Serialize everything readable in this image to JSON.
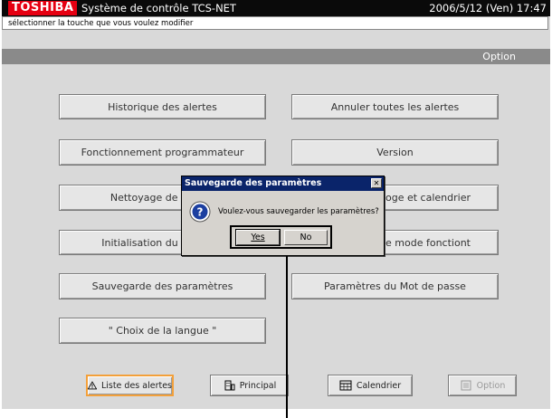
{
  "header": {
    "brand": "TOSHIBA",
    "app_title": "Système de contrôle TCS-NET",
    "datetime": "2006/5/12 (Ven)  17:47",
    "hint": "sélectionner la touche que vous voulez modifier"
  },
  "section": {
    "title": "Option"
  },
  "menu": [
    {
      "id": "history",
      "label": "Historique des alertes"
    },
    {
      "id": "cancel-alerts",
      "label": "Annuler toutes les alertes"
    },
    {
      "id": "scheduler",
      "label": "Fonctionnement programmateur"
    },
    {
      "id": "version",
      "label": "Version"
    },
    {
      "id": "cleaning",
      "label": "Nettoyage de l'écran"
    },
    {
      "id": "clock",
      "label": "Horloge et calendrier"
    },
    {
      "id": "init",
      "label": "Initialisation du système"
    },
    {
      "id": "mode",
      "label": "Blocage mode fonctiont"
    },
    {
      "id": "save-params",
      "label": "Sauvegarde des paramètres"
    },
    {
      "id": "password",
      "label": "Paramètres du Mot de passe"
    },
    {
      "id": "language",
      "label": "\" Choix de la langue \""
    }
  ],
  "bottom_nav": [
    {
      "id": "alerts",
      "label": "Liste des alertes",
      "icon": "warning-icon",
      "active": true
    },
    {
      "id": "main",
      "label": "Principal",
      "icon": "building-icon"
    },
    {
      "id": "calendar",
      "label": "Calendrier",
      "icon": "calendar-icon"
    },
    {
      "id": "option",
      "label": "Option",
      "icon": "option-icon",
      "disabled": true
    }
  ],
  "dialog": {
    "title": "Sauvegarde des paramètres",
    "message": "Voulez-vous sauvegarder les paramètres?",
    "yes": "Yes",
    "no": "No",
    "icon": "question-icon"
  },
  "colors": {
    "brand_red": "#e60012",
    "titlebar": "#0a0a0a",
    "section_bar": "#8a8a8a",
    "background": "#d9d9d9",
    "dialog_title": "#0a246a",
    "active_border": "#f3a03a"
  }
}
